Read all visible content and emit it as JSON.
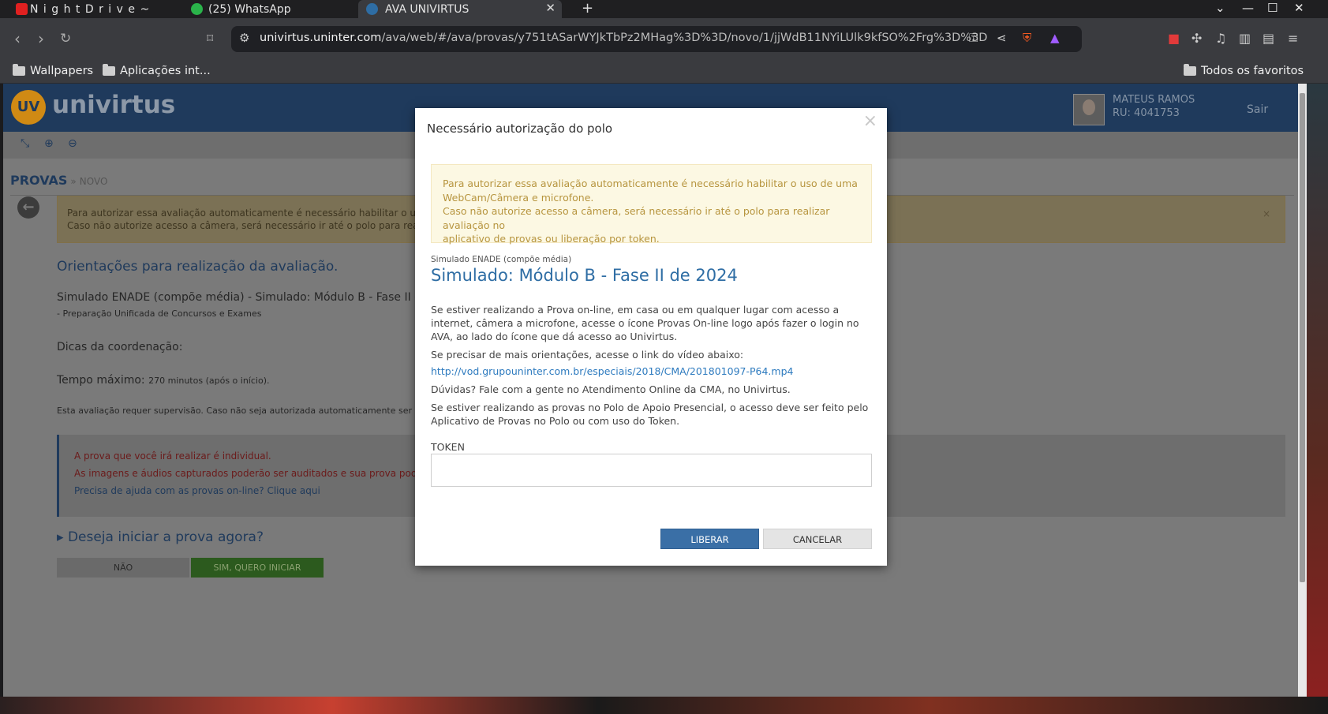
{
  "browser": {
    "tabs": [
      {
        "title": "N i g h t  D r i v e ~",
        "active": false
      },
      {
        "title": "(25) WhatsApp",
        "active": false
      },
      {
        "title": "AVA UNIVIRTUS",
        "active": true
      }
    ],
    "url_host": "univirtus.uninter.com",
    "url_path": "/ava/web/#/ava/provas/y751tASarWYJkTbPz2MHag%3D%3D/novo/1/jjWdB11NYiLUlk9kfSO%2Frg%3D%3D",
    "bookmarks": [
      "Wallpapers",
      "Aplicações int...",
      "Todos os favoritos"
    ]
  },
  "header": {
    "logo_mark": "UV",
    "logo_text": "univirtus",
    "user_name": "MATEUS RAMOS",
    "user_ru": "RU: 4041753",
    "logout": "Sair"
  },
  "breadcrumb": {
    "main": "PROVAS",
    "sep": "»",
    "sub": "NOVO"
  },
  "background": {
    "alert_line1": "Para autorizar essa avaliação automaticamente é necessário habilitar o uso de",
    "alert_line2": "Caso não autorize acesso a câmera, será necessário ir até o polo para realizar",
    "alert_close": "×",
    "heading": "Orientações para realização da avaliação.",
    "exam_title": "Simulado ENADE (compõe média) - Simulado: Módulo B - Fase II d",
    "exam_course": " - Preparação Unificada de Concursos e Exames",
    "tips_label": "Dicas da coordenação:",
    "time_label": "Tempo máximo:",
    "time_value": "270 minutos (após o início).",
    "supervision": "Esta avaliação requer supervisão. Caso não seja autorizada automaticamente ser",
    "notice1": "A prova que você irá realizar é individual.",
    "notice2": "As imagens e áudios capturados poderão ser auditados e sua prova poderá s",
    "help_link": "Precisa de ajuda com as provas on-line? Clique aqui",
    "start_question": "Deseja iniciar a prova agora?",
    "btn_no": "NÃO",
    "btn_yes": "SIM, QUERO INICIAR"
  },
  "modal": {
    "title": "Necessário autorização do polo",
    "close": "×",
    "alert_line1": "Para autorizar essa avaliação automaticamente é necessário habilitar o uso de uma",
    "alert_line2": "WebCam/Câmera e microfone.",
    "alert_line3": "Caso não autorize acesso a câmera, será necessário ir até o polo para realizar avaliação no",
    "alert_line4": "aplicativo de provas ou liberação por token.",
    "subtitle": "Simulado ENADE (compõe média)",
    "heading": "Simulado: Módulo B - Fase II de 2024",
    "p1": "Se estiver realizando a Prova on-line, em casa ou em qualquer lugar com acesso a internet, câmera a microfone, acesse o ícone Provas On-line logo após fazer o login no AVA, ao lado do ícone que dá acesso ao Univirtus.",
    "p2": "Se precisar de mais orientações, acesse o link do vídeo abaixo:",
    "video_link": "http://vod.grupouninter.com.br/especiais/2018/CMA/201801097-P64.mp4",
    "p3": "Dúvidas? Fale com a gente no Atendimento Online da CMA, no Univirtus.",
    "p4": "Se estiver realizando as provas no Polo de Apoio Presencial, o acesso deve ser feito pelo Aplicativo de Provas no Polo ou com uso do Token.",
    "token_label": "TOKEN",
    "token_value": "",
    "btn_release": "LIBERAR",
    "btn_cancel": "CANCELAR"
  }
}
